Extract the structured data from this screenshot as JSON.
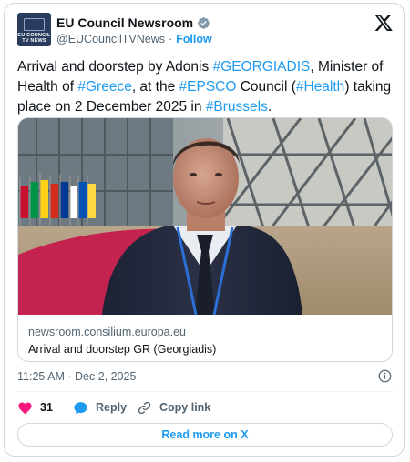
{
  "author": {
    "display_name": "EU Council Newsroom",
    "handle": "@EUCouncilTVNews",
    "separator": "·",
    "follow_label": "Follow",
    "avatar_line1": "EU COUNCIL",
    "avatar_line2": "TV NEWS"
  },
  "tweet": {
    "t1": "Arrival and doorstep by Adonis ",
    "tag1": "#GEORGIADIS",
    "t2": ", Minister of Health of ",
    "tag2": "#Greece",
    "t3": ", at the ",
    "tag3": "#EPSCO",
    "t4": " Council (",
    "tag4": "#Health",
    "t5": ") taking place on 2 December 2025 in ",
    "tag5": "#Brussels",
    "t6": "."
  },
  "media": {
    "domain": "newsroom.consilium.europa.eu",
    "title": "Arrival and doorstep GR (Georgiadis)"
  },
  "meta": {
    "timestamp": "11:25 AM · Dec 2, 2025"
  },
  "actions": {
    "like_count": "31",
    "reply_label": "Reply",
    "copy_link_label": "Copy link"
  },
  "read_more_label": "Read more on X",
  "colors": {
    "accent": "#1d9bf0",
    "heart": "#f91880",
    "text": "#0f1419",
    "muted": "#536471",
    "border": "#cfd9de"
  },
  "icons": [
    "verified-badge-icon",
    "x-logo-icon",
    "info-icon",
    "heart-icon",
    "reply-bubble-icon",
    "link-icon"
  ]
}
